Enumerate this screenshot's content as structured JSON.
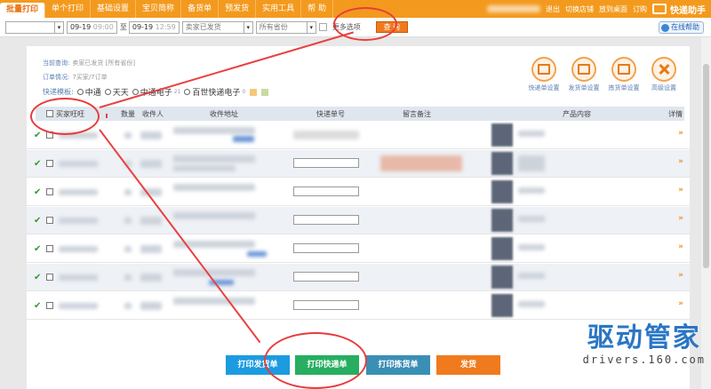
{
  "nav": {
    "tabs": [
      "批量打印",
      "单个打印",
      "基础设置",
      "宝贝简称",
      "备货单",
      "预发货",
      "实用工具",
      "帮 助"
    ],
    "right_links": [
      "退出",
      "切换店铺",
      "放到桌面",
      "订购"
    ],
    "app_name": "快递助手"
  },
  "filter": {
    "date_from": "09-19",
    "time_from": "09:00",
    "to_label": "至",
    "date_to": "09-19",
    "time_to": "12:59",
    "status_select": "卖家已发货",
    "province_select": "所有省份",
    "more_options": "更多选项",
    "query_button": "查 询",
    "help_button": "在线帮助"
  },
  "info": {
    "current_query_label": "当前查询:",
    "current_query_value": "卖家已发货 [所有省份]",
    "order_status_label": "订单情况:",
    "order_status_value": "7买家/7订单",
    "carrier_label": "快递模板:",
    "carriers": [
      {
        "name": "中通",
        "sub": ""
      },
      {
        "name": "天天",
        "sub": ""
      },
      {
        "name": "中通电子",
        "sub": "21"
      },
      {
        "name": "百世快递电子",
        "sub": "0"
      }
    ]
  },
  "tools": [
    "快递单设置",
    "发货单设置",
    "拣货单设置",
    "高级设置"
  ],
  "table": {
    "headers": [
      "买家旺旺",
      "数量",
      "收件人",
      "收件地址",
      "快递单号",
      "留言备注",
      "产品内容",
      "详情"
    ]
  },
  "buttons": {
    "print_invoice": "打印发货单",
    "print_express": "打印快递单",
    "print_picking": "打印拣货单",
    "ship": "发货"
  },
  "watermark": {
    "text": "驱动管家",
    "url": "drivers.160.com"
  },
  "colors": {
    "brand_orange": "#f39a1e",
    "button_blue": "#1d9be0",
    "button_green": "#27ae60",
    "button_slate": "#3a8fb5",
    "button_orange": "#f07b1e",
    "annotation_red": "#e83c3c"
  }
}
